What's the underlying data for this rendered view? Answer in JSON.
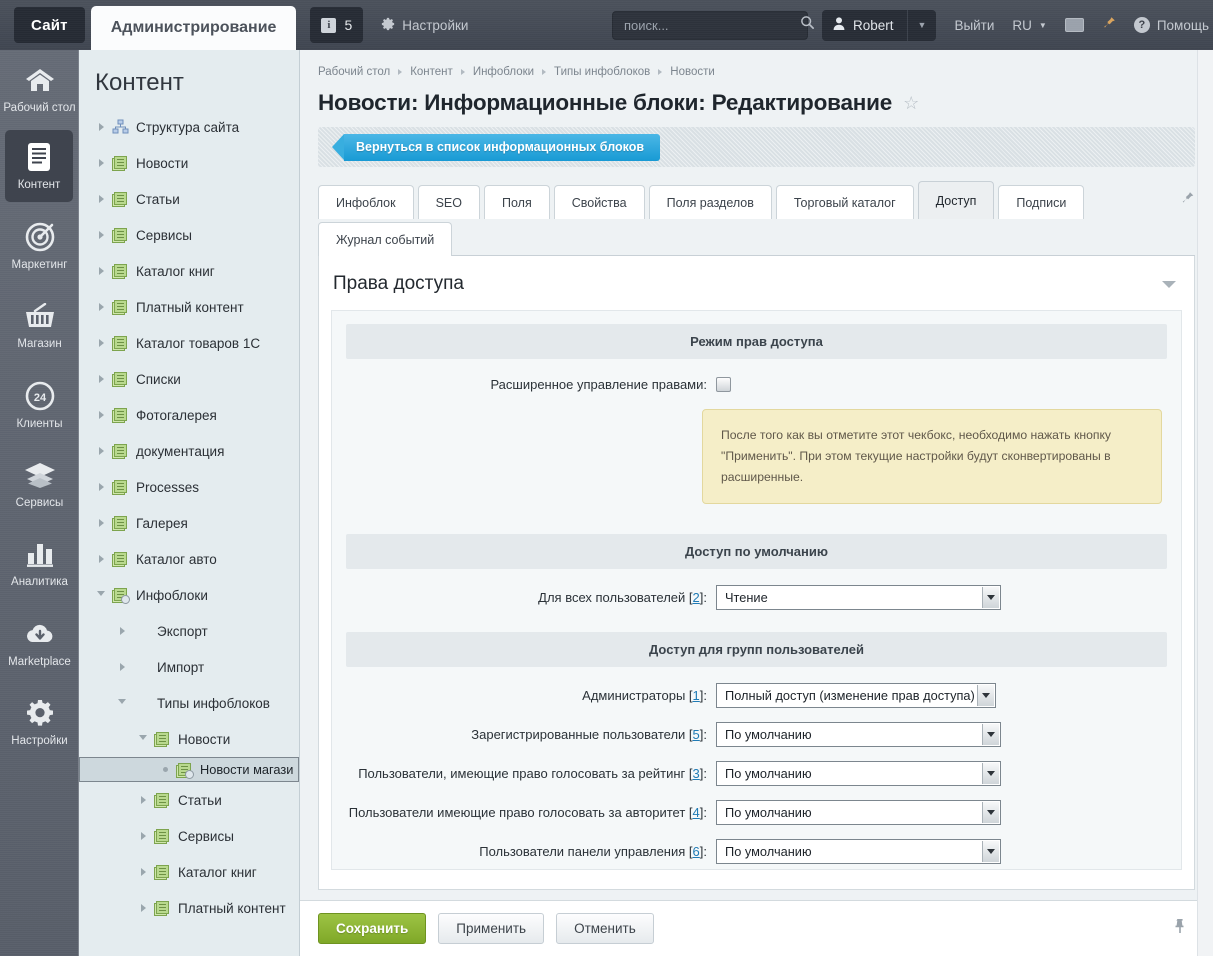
{
  "topbar": {
    "site_tab": "Сайт",
    "admin_tab": "Администрирование",
    "info_badge_letter": "i",
    "info_count": "5",
    "settings_label": "Настройки",
    "search_placeholder": "поиск...",
    "search_value": "",
    "user_name": "Robert",
    "logout": "Выйти",
    "lang": "RU",
    "help": "Помощь",
    "icons": [
      "gear-icon",
      "search-icon",
      "user-icon",
      "chevron-down-icon",
      "keyboard-icon",
      "pin-icon",
      "help-icon"
    ]
  },
  "rail": {
    "items": [
      {
        "label": "Рабочий стол",
        "icon": "home-icon",
        "active": false
      },
      {
        "label": "Контент",
        "icon": "document-icon",
        "active": true
      },
      {
        "label": "Маркетинг",
        "icon": "target-icon",
        "active": false
      },
      {
        "label": "Магазин",
        "icon": "basket-icon",
        "active": false
      },
      {
        "label": "Клиенты",
        "icon": "24-circle-icon",
        "active": false
      },
      {
        "label": "Сервисы",
        "icon": "layers-icon",
        "active": false
      },
      {
        "label": "Аналитика",
        "icon": "bar-chart-icon",
        "active": false
      },
      {
        "label": "Marketplace",
        "icon": "cloud-download-icon",
        "active": false
      },
      {
        "label": "Настройки",
        "icon": "gear-icon",
        "active": false
      }
    ]
  },
  "tree": {
    "title": "Контент",
    "nodes": [
      {
        "label": "Структура сайта",
        "indent": 0,
        "arrow": "closed",
        "icon": "sitemap-icon",
        "selected": false
      },
      {
        "label": "Новости",
        "indent": 0,
        "arrow": "closed",
        "icon": "infoblock-icon",
        "selected": false
      },
      {
        "label": "Статьи",
        "indent": 0,
        "arrow": "closed",
        "icon": "infoblock-icon",
        "selected": false
      },
      {
        "label": "Сервисы",
        "indent": 0,
        "arrow": "closed",
        "icon": "infoblock-icon",
        "selected": false
      },
      {
        "label": "Каталог книг",
        "indent": 0,
        "arrow": "closed",
        "icon": "infoblock-icon",
        "selected": false
      },
      {
        "label": "Платный контент",
        "indent": 0,
        "arrow": "closed",
        "icon": "infoblock-icon",
        "selected": false
      },
      {
        "label": "Каталог товаров 1С",
        "indent": 0,
        "arrow": "closed",
        "icon": "infoblock-icon",
        "selected": false
      },
      {
        "label": "Списки",
        "indent": 0,
        "arrow": "closed",
        "icon": "infoblock-icon",
        "selected": false
      },
      {
        "label": "Фотогалерея",
        "indent": 0,
        "arrow": "closed",
        "icon": "infoblock-icon",
        "selected": false
      },
      {
        "label": "документация",
        "indent": 0,
        "arrow": "closed",
        "icon": "infoblock-icon",
        "selected": false
      },
      {
        "label": "Processes",
        "indent": 0,
        "arrow": "closed",
        "icon": "infoblock-icon",
        "selected": false
      },
      {
        "label": "Галерея",
        "indent": 0,
        "arrow": "closed",
        "icon": "infoblock-icon",
        "selected": false
      },
      {
        "label": "Каталог авто",
        "indent": 0,
        "arrow": "closed",
        "icon": "infoblock-icon",
        "selected": false
      },
      {
        "label": "Инфоблоки",
        "indent": 0,
        "arrow": "open",
        "icon": "infoblock-gear-icon",
        "selected": false
      },
      {
        "label": "Экспорт",
        "indent": 1,
        "arrow": "closed",
        "icon": "none",
        "selected": false
      },
      {
        "label": "Импорт",
        "indent": 1,
        "arrow": "closed",
        "icon": "none",
        "selected": false
      },
      {
        "label": "Типы инфоблоков",
        "indent": 1,
        "arrow": "open",
        "icon": "none",
        "selected": false
      },
      {
        "label": "Новости",
        "indent": 2,
        "arrow": "open",
        "icon": "infoblock-icon",
        "selected": false
      },
      {
        "label": "Новости магази",
        "indent": 3,
        "arrow": "dot",
        "icon": "infoblock-gear-icon",
        "selected": true
      },
      {
        "label": "Статьи",
        "indent": 2,
        "arrow": "closed",
        "icon": "infoblock-icon",
        "selected": false
      },
      {
        "label": "Сервисы",
        "indent": 2,
        "arrow": "closed",
        "icon": "infoblock-icon",
        "selected": false
      },
      {
        "label": "Каталог книг",
        "indent": 2,
        "arrow": "closed",
        "icon": "infoblock-icon",
        "selected": false
      },
      {
        "label": "Платный контент",
        "indent": 2,
        "arrow": "closed",
        "icon": "infoblock-icon",
        "selected": false
      }
    ]
  },
  "main": {
    "breadcrumbs": [
      "Рабочий стол",
      "Контент",
      "Инфоблоки",
      "Типы инфоблоков",
      "Новости"
    ],
    "page_title": "Новости: Информационные блоки: Редактирование",
    "favorite_icon": "star-icon",
    "back_button": "Вернуться в список информационных блоков",
    "tabs_row1": [
      {
        "label": "Инфоблок",
        "active": false
      },
      {
        "label": "SEO",
        "active": false
      },
      {
        "label": "Поля",
        "active": false
      },
      {
        "label": "Свойства",
        "active": false
      },
      {
        "label": "Поля разделов",
        "active": false
      },
      {
        "label": "Торговый каталог",
        "active": false
      },
      {
        "label": "Доступ",
        "active": true
      },
      {
        "label": "Подписи",
        "active": false
      }
    ],
    "tabs_row2": [
      {
        "label": "Журнал событий",
        "active": false
      }
    ],
    "panel_title": "Права доступа",
    "sections": {
      "mode": "Режим прав доступа",
      "default": "Доступ по умолчанию",
      "groups": "Доступ для групп пользователей"
    },
    "extended_label": "Расширенное управление правами:",
    "extended_checked": false,
    "note": "После того как вы отметите этот чекбокс, необходимо нажать кнопку \"Применить\". При этом текущие настройки будут сконвертированы в расширенные.",
    "default_row": {
      "label": "Для всех пользователей",
      "ref": "2",
      "value": "Чтение"
    },
    "group_rows": [
      {
        "label": "Администраторы",
        "ref": "1",
        "value": "Полный доступ (изменение прав доступа)"
      },
      {
        "label": "Зарегистрированные пользователи",
        "ref": "5",
        "value": "По умолчанию"
      },
      {
        "label": "Пользователи, имеющие право голосовать за рейтинг",
        "ref": "3",
        "value": "По умолчанию"
      },
      {
        "label": "Пользователи имеющие право голосовать за авторитет",
        "ref": "4",
        "value": "По умолчанию"
      },
      {
        "label": "Пользователи панели управления",
        "ref": "6",
        "value": "По умолчанию"
      }
    ]
  },
  "footer": {
    "save": "Сохранить",
    "apply": "Применить",
    "cancel": "Отменить",
    "pin_icon": "pin-icon"
  },
  "colors": {
    "accent_blue": "#2aa8de",
    "save_green": "#8fb733",
    "topbar_dark": "#454b55",
    "tree_bg": "#e4ecef",
    "note_bg": "#f5eec8"
  }
}
